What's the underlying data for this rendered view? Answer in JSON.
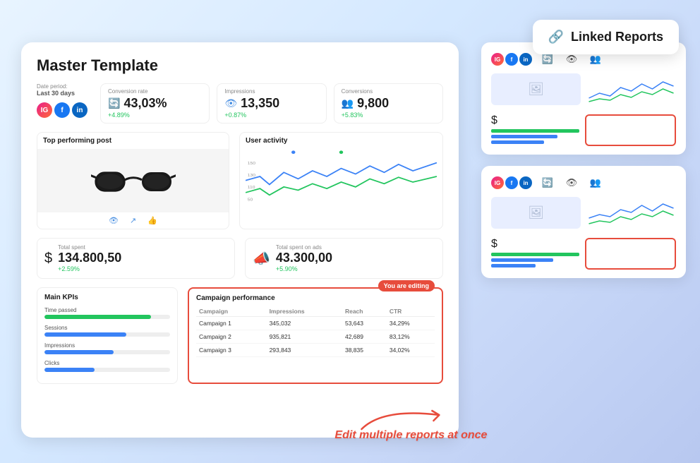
{
  "linked_reports": {
    "button_label": "Linked Reports",
    "link_icon": "🔗"
  },
  "main_card": {
    "title": "Master Template",
    "date_label": "Date period:",
    "date_value": "Last 30 days",
    "metrics": [
      {
        "label": "Conversion rate",
        "value": "43,03%",
        "change": "+4.89%",
        "icon": "🔄"
      },
      {
        "label": "Impressions",
        "value": "13,350",
        "change": "+0.87%",
        "icon": "👁"
      },
      {
        "label": "Conversions",
        "value": "9,800",
        "change": "+5.83%",
        "icon": "👥"
      }
    ],
    "top_post": {
      "title": "Top performing post"
    },
    "user_activity": {
      "title": "User activity"
    },
    "total_spent": {
      "label": "Total spent",
      "value": "134.800,50",
      "change": "+2.59%"
    },
    "total_spent_ads": {
      "label": "Total spent on ads",
      "value": "43.300,00",
      "change": "+5.90%"
    },
    "kpis": {
      "title": "Main KPIs",
      "items": [
        {
          "label": "Time passed",
          "value": 85,
          "color": "#22c55e"
        },
        {
          "label": "Sessions",
          "value": 65,
          "color": "#3b82f6"
        },
        {
          "label": "Impressions",
          "value": 55,
          "color": "#3b82f6"
        },
        {
          "label": "Clicks",
          "value": 40,
          "color": "#3b82f6"
        }
      ]
    },
    "campaign": {
      "title": "Campaign performance",
      "editing_badge": "You are editing",
      "columns": [
        "Campaign",
        "Impressions",
        "Reach",
        "CTR"
      ],
      "rows": [
        [
          "Campaign 1",
          "345,032",
          "53,643",
          "34,29%"
        ],
        [
          "Campaign 2",
          "935,821",
          "42,689",
          "83,12%"
        ],
        [
          "Campaign 3",
          "293,843",
          "38,835",
          "34,02%"
        ]
      ]
    }
  },
  "report_cards": [
    {
      "id": 1,
      "has_red_border": false
    },
    {
      "id": 2,
      "has_red_border": false
    }
  ],
  "annotation": {
    "text": "Edit multiple reports at once"
  }
}
